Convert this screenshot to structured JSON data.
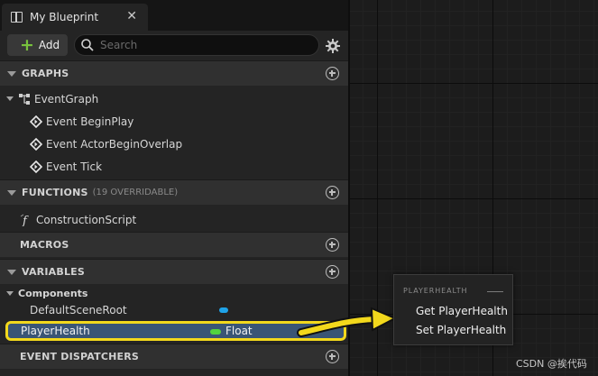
{
  "tab": {
    "title": "My Blueprint",
    "close": "✕"
  },
  "toolbar": {
    "add_label": "Add",
    "add_symbol": "+",
    "search_placeholder": "Search"
  },
  "sections": {
    "graphs": "GRAPHS",
    "functions": "FUNCTIONS",
    "functions_sub": "(19 OVERRIDABLE)",
    "macros": "MACROS",
    "variables": "VARIABLES",
    "dispatchers": "EVENT DISPATCHERS"
  },
  "graphs": {
    "event_graph": "EventGraph",
    "events": [
      "Event BeginPlay",
      "Event ActorBeginOverlap",
      "Event Tick"
    ]
  },
  "functions": {
    "construction": "ConstructionScript"
  },
  "variables": {
    "components_label": "Components",
    "default_scene_root": "DefaultSceneRoot",
    "selected": {
      "name": "PlayerHealth",
      "type": "Float"
    }
  },
  "popup": {
    "title": "PLAYERHEALTH",
    "get": "Get PlayerHealth",
    "set": "Set PlayerHealth"
  },
  "watermark": "CSDN @挨代码",
  "colors": {
    "selection_bg": "#3a5575",
    "highlight_border": "#f2d81c",
    "float_pin": "#52d33e",
    "component_pin": "#1fa3e8",
    "add_plus": "#78c23d"
  },
  "icons": {
    "tab": "blueprint-icon",
    "search": "search-icon",
    "settings": "gear-icon",
    "graph": "graph-icon",
    "event": "event-diamond-icon",
    "function": "function-icon"
  }
}
